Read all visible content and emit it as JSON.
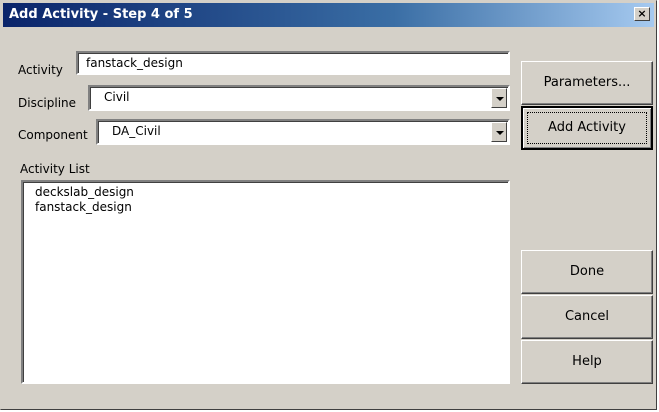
{
  "window": {
    "title": "Add Activity - Step 4 of 5",
    "close_symbol": "×"
  },
  "form": {
    "activity_label": "Activity",
    "activity_value": "fanstack_design",
    "discipline_label": "Discipline",
    "discipline_value": "Civil",
    "component_label": "Component",
    "component_value": "DA_Civil"
  },
  "activity_list": {
    "label": "Activity List",
    "items": [
      "deckslab_design",
      "fanstack_design"
    ]
  },
  "buttons": {
    "parameters": "Parameters...",
    "add_activity": "Add Activity",
    "done": "Done",
    "cancel": "Cancel",
    "help": "Help"
  },
  "icons": {
    "close": "close-icon",
    "dropdown": "chevron-down-icon"
  }
}
